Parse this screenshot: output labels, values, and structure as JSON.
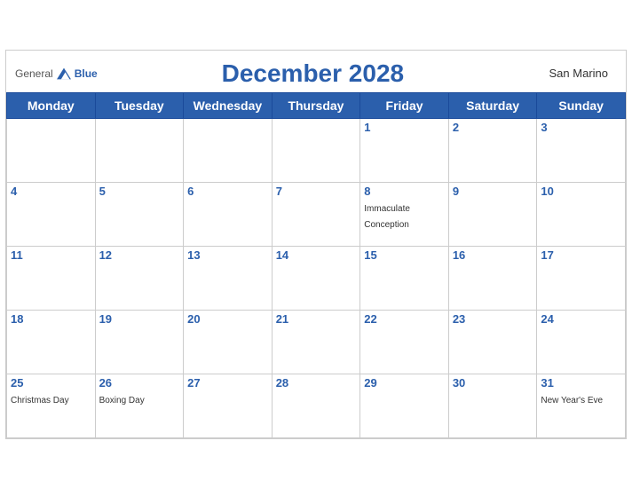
{
  "header": {
    "logo_general": "General",
    "logo_blue": "Blue",
    "title": "December 2028",
    "country": "San Marino"
  },
  "weekdays": [
    "Monday",
    "Tuesday",
    "Wednesday",
    "Thursday",
    "Friday",
    "Saturday",
    "Sunday"
  ],
  "weeks": [
    [
      {
        "day": "",
        "event": ""
      },
      {
        "day": "",
        "event": ""
      },
      {
        "day": "",
        "event": ""
      },
      {
        "day": "",
        "event": ""
      },
      {
        "day": "1",
        "event": ""
      },
      {
        "day": "2",
        "event": ""
      },
      {
        "day": "3",
        "event": ""
      }
    ],
    [
      {
        "day": "4",
        "event": ""
      },
      {
        "day": "5",
        "event": ""
      },
      {
        "day": "6",
        "event": ""
      },
      {
        "day": "7",
        "event": ""
      },
      {
        "day": "8",
        "event": "Immaculate Conception"
      },
      {
        "day": "9",
        "event": ""
      },
      {
        "day": "10",
        "event": ""
      }
    ],
    [
      {
        "day": "11",
        "event": ""
      },
      {
        "day": "12",
        "event": ""
      },
      {
        "day": "13",
        "event": ""
      },
      {
        "day": "14",
        "event": ""
      },
      {
        "day": "15",
        "event": ""
      },
      {
        "day": "16",
        "event": ""
      },
      {
        "day": "17",
        "event": ""
      }
    ],
    [
      {
        "day": "18",
        "event": ""
      },
      {
        "day": "19",
        "event": ""
      },
      {
        "day": "20",
        "event": ""
      },
      {
        "day": "21",
        "event": ""
      },
      {
        "day": "22",
        "event": ""
      },
      {
        "day": "23",
        "event": ""
      },
      {
        "day": "24",
        "event": ""
      }
    ],
    [
      {
        "day": "25",
        "event": "Christmas Day"
      },
      {
        "day": "26",
        "event": "Boxing Day"
      },
      {
        "day": "27",
        "event": ""
      },
      {
        "day": "28",
        "event": ""
      },
      {
        "day": "29",
        "event": ""
      },
      {
        "day": "30",
        "event": ""
      },
      {
        "day": "31",
        "event": "New Year's Eve"
      }
    ]
  ]
}
